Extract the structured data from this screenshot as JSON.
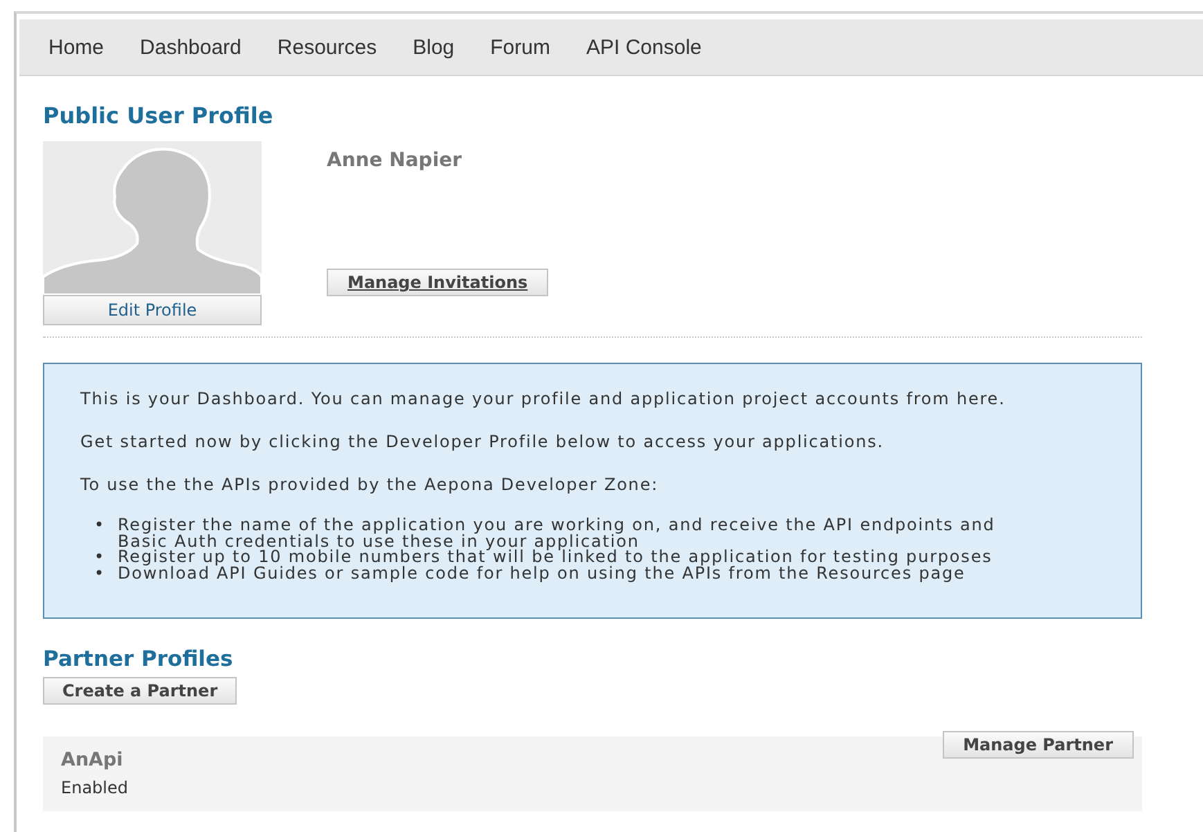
{
  "nav": [
    {
      "label": "Home"
    },
    {
      "label": "Dashboard"
    },
    {
      "label": "Resources"
    },
    {
      "label": "Blog"
    },
    {
      "label": "Forum"
    },
    {
      "label": "API Console"
    }
  ],
  "profile": {
    "heading": "Public User Profile",
    "name": "Anne Napier",
    "edit_button": "Edit Profile",
    "invitations_button": "Manage Invitations"
  },
  "info": {
    "paragraphs": [
      "This is your Dashboard. You can manage your profile and application project accounts from here.",
      "Get started now by clicking the Developer Profile below to access your applications.",
      "To use the the APIs provided by the Aepona Developer Zone:"
    ],
    "bullets": [
      {
        "marker": "•",
        "text": "Register the name of the application you are working on, and receive the API endpoints and Basic Auth credentials to use these in your application"
      },
      {
        "marker": "•",
        "text": "Register up to 10 mobile numbers that will be linked to the application for testing purposes"
      },
      {
        "marker": "•",
        "text": "Download API Guides or sample code for help on using the APIs from the Resources page"
      }
    ]
  },
  "partners": {
    "heading": "Partner Profiles",
    "create_button": "Create a Partner",
    "items": [
      {
        "name": "AnApi",
        "status": "Enabled",
        "button": "Manage Partner"
      }
    ]
  }
}
